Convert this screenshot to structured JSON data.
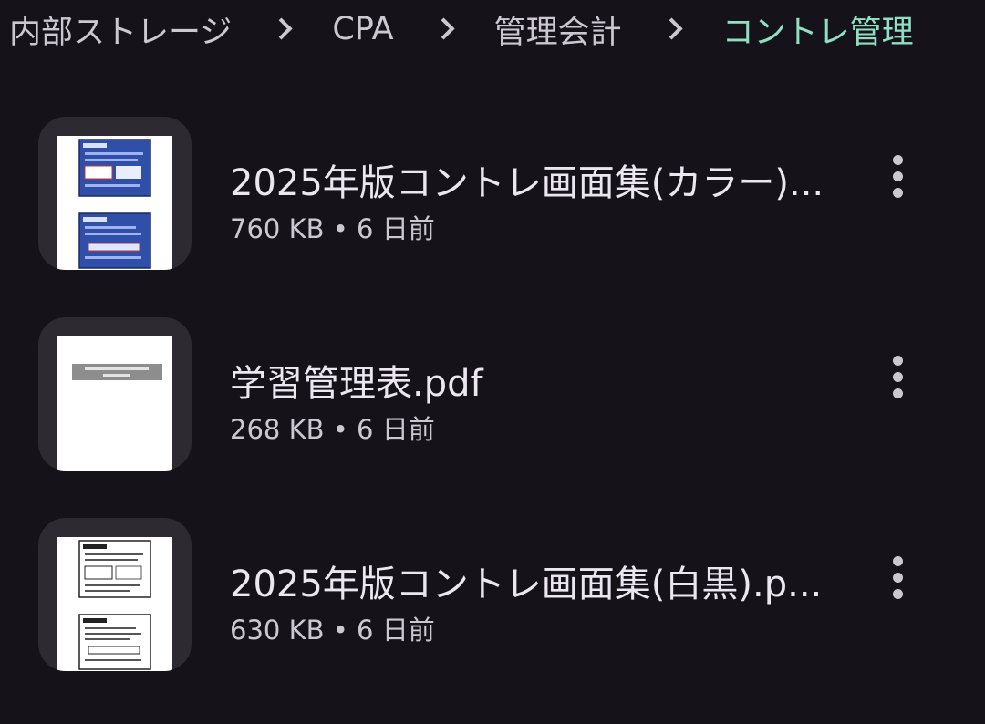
{
  "breadcrumb": {
    "items": [
      {
        "label": "内部ストレージ"
      },
      {
        "label": "CPA"
      },
      {
        "label": "管理会計"
      },
      {
        "label": "コントレ管理"
      }
    ],
    "current_color": "#8fe0c2"
  },
  "files": [
    {
      "name": "2025年版コントレ画面集(カラー)...",
      "meta": "760 KB • 6 日前",
      "thumbnail": "color-slides-preview"
    },
    {
      "name": "学習管理表.pdf",
      "meta": "268 KB • 6 日前",
      "thumbnail": "gray-header-pdf-preview"
    },
    {
      "name": "2025年版コントレ画面集(白黒).p...",
      "meta": "630 KB • 6 日前",
      "thumbnail": "bw-slides-preview"
    }
  ],
  "icons": {
    "breadcrumb_separator": "chevron-right-icon",
    "more_options": "more-vert-icon"
  },
  "colors": {
    "background": "#15121a",
    "primary_text": "#ece6f0",
    "secondary_text": "#cdc7d2",
    "thumbnail_frame": "#2d2a31"
  }
}
